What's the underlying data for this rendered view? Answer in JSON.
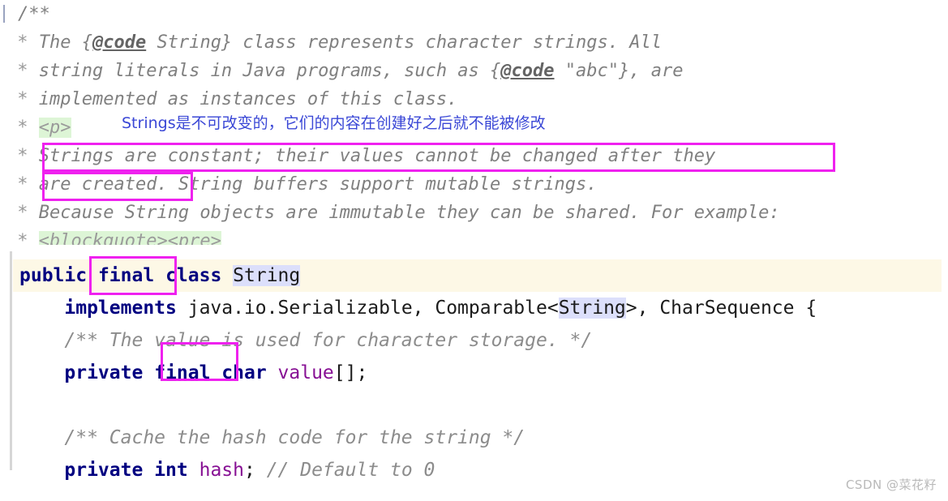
{
  "javadoc": {
    "lines": [
      {
        "prefix": "",
        "text": "/**"
      },
      {
        "prefix": " * ",
        "text": "The {@code String} class represents character strings. All"
      },
      {
        "prefix": " * ",
        "text": "string literals in Java programs, such as {@code \"abc\"}, are"
      },
      {
        "prefix": " * ",
        "text": "implemented as instances of this class."
      },
      {
        "prefix": " * ",
        "text": "<p>"
      },
      {
        "prefix": " * ",
        "text": "Strings are constant; their values cannot be changed after they"
      },
      {
        "prefix": " * ",
        "text": "are created. String buffers support mutable strings."
      },
      {
        "prefix": " * ",
        "text": "Because String objects are immutable they can be shared. For example:"
      },
      {
        "prefix": " * ",
        "text": "<blockquote><pre>"
      }
    ],
    "inline_tokens": {
      "code_tag": "@code",
      "string_literal": "\"abc\"",
      "p_tag": "<p>",
      "blockquote_tag": "<blockquote><pre>"
    }
  },
  "annotation": {
    "chinese_note": "Strings是不可改变的，它们的内容在创建好之后就不能被修改",
    "note_color": "#3a47d6",
    "highlight_box_color": "#ef21ef",
    "boxed_phrases": [
      "Strings are constant; their values cannot be changed after they",
      "are created.",
      "final",
      "final"
    ]
  },
  "code": {
    "current_line_highlight_color": "#fdf8e6",
    "selection_color": "#dcdffb",
    "keyword_color": "#000080",
    "field_color": "#871094",
    "comment_color": "#8c8c8c",
    "lines": [
      {
        "id": "class-decl",
        "highlighted": true,
        "tokens": [
          {
            "t": "public",
            "c": "kw"
          },
          {
            "t": " ",
            "c": "plain"
          },
          {
            "t": "final",
            "c": "kw"
          },
          {
            "t": " ",
            "c": "plain"
          },
          {
            "t": "class",
            "c": "kw"
          },
          {
            "t": " ",
            "c": "plain"
          },
          {
            "t": "String",
            "c": "plain sel"
          }
        ]
      },
      {
        "id": "implements-decl",
        "highlighted": false,
        "tokens": [
          {
            "t": "    ",
            "c": "plain"
          },
          {
            "t": "implements",
            "c": "kw"
          },
          {
            "t": " java.io.Serializable, Comparable<",
            "c": "plain"
          },
          {
            "t": "String",
            "c": "plain sel"
          },
          {
            "t": ">, CharSequence {",
            "c": "plain"
          }
        ]
      },
      {
        "id": "value-doc",
        "highlighted": false,
        "tokens": [
          {
            "t": "    ",
            "c": "plain"
          },
          {
            "t": "/** The value is used for character storage. */",
            "c": "cmt"
          }
        ]
      },
      {
        "id": "value-field",
        "highlighted": false,
        "tokens": [
          {
            "t": "    ",
            "c": "plain"
          },
          {
            "t": "private",
            "c": "kw"
          },
          {
            "t": " ",
            "c": "plain"
          },
          {
            "t": "final",
            "c": "kw"
          },
          {
            "t": " ",
            "c": "plain"
          },
          {
            "t": "char",
            "c": "kw"
          },
          {
            "t": " ",
            "c": "plain"
          },
          {
            "t": "value",
            "c": "fld"
          },
          {
            "t": "[];",
            "c": "punct"
          }
        ]
      },
      {
        "id": "blank-1",
        "highlighted": false,
        "tokens": [
          {
            "t": " ",
            "c": "plain"
          }
        ]
      },
      {
        "id": "hash-doc",
        "highlighted": false,
        "tokens": [
          {
            "t": "    ",
            "c": "plain"
          },
          {
            "t": "/** Cache the hash code for the string */",
            "c": "cmt"
          }
        ]
      },
      {
        "id": "hash-field",
        "highlighted": false,
        "tokens": [
          {
            "t": "    ",
            "c": "plain"
          },
          {
            "t": "private",
            "c": "kw"
          },
          {
            "t": " ",
            "c": "plain"
          },
          {
            "t": "int",
            "c": "kw"
          },
          {
            "t": " ",
            "c": "plain"
          },
          {
            "t": "hash",
            "c": "fld"
          },
          {
            "t": "; ",
            "c": "punct"
          },
          {
            "t": "// Default to 0",
            "c": "cmt"
          }
        ]
      }
    ]
  },
  "watermark": {
    "text": "CSDN @菜花籽"
  }
}
